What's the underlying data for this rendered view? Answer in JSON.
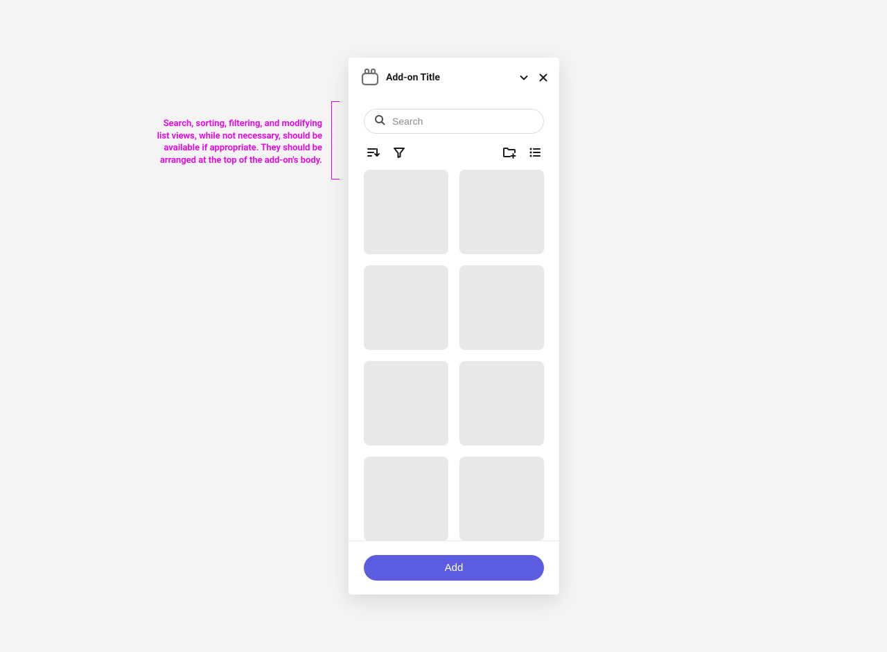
{
  "annotation": {
    "text": "Search, sorting, filtering, and modifying list views, while not necessary, should be available if appropriate. They should be arranged at the top of the add-on's body."
  },
  "header": {
    "title": "Add-on Title"
  },
  "search": {
    "placeholder": "Search",
    "value": ""
  },
  "toolbar": {
    "icons": {
      "sort": "sort-icon",
      "filter": "filter-icon",
      "folder_add": "folder-add-icon",
      "list_view": "list-view-icon"
    }
  },
  "grid": {
    "item_count": 8
  },
  "footer": {
    "add_label": "Add"
  }
}
